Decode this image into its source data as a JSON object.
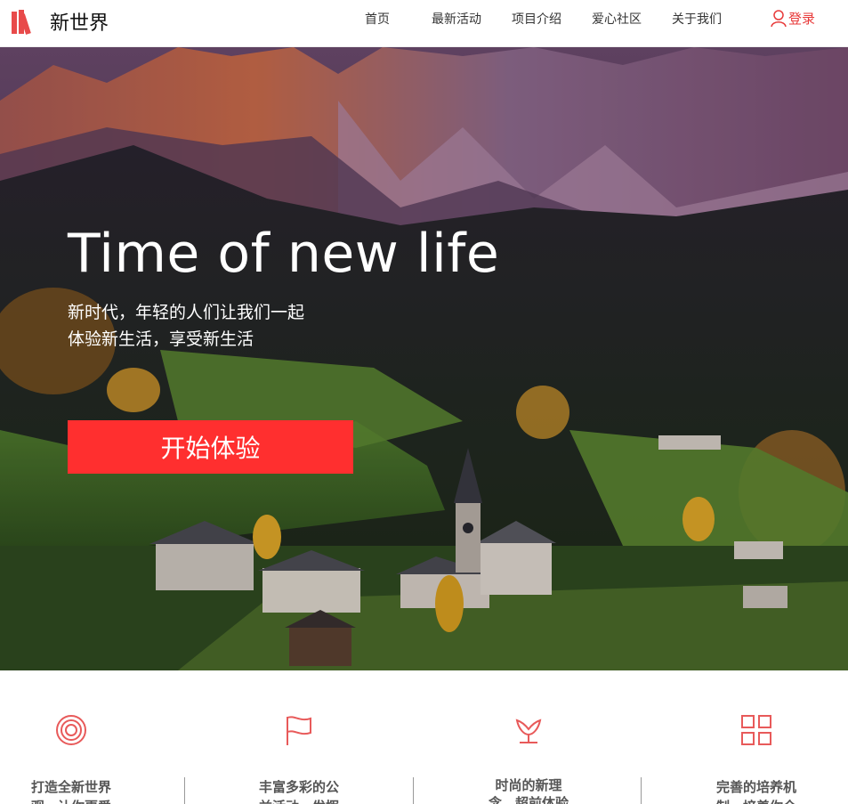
{
  "header": {
    "logo_text": "新世界",
    "nav": [
      "首页",
      "最新活动",
      "项目介绍",
      "爱心社区",
      "关于我们"
    ],
    "login_label": "登录"
  },
  "hero": {
    "title": "Time of new life",
    "subtitle_line1": "新时代，年轻的人们让我们一起",
    "subtitle_line2": "体验新生活，享受新生活",
    "cta_label": "开始体验"
  },
  "features": [
    {
      "icon": "target-icon",
      "text_line1": "打造全新世界",
      "text_line2": "观，让你更爱"
    },
    {
      "icon": "flag-icon",
      "text_line1": "丰富多彩的公",
      "text_line2": "益活动，发挥"
    },
    {
      "icon": "flower-icon",
      "text_line1": "时尚的新理",
      "text_line2": "念，超前体验"
    },
    {
      "icon": "grid-icon",
      "text_line1": "完善的培养机",
      "text_line2": "制，培养你全"
    }
  ],
  "colors": {
    "accent": "#e83a3a",
    "cta": "#ff2f2f"
  }
}
